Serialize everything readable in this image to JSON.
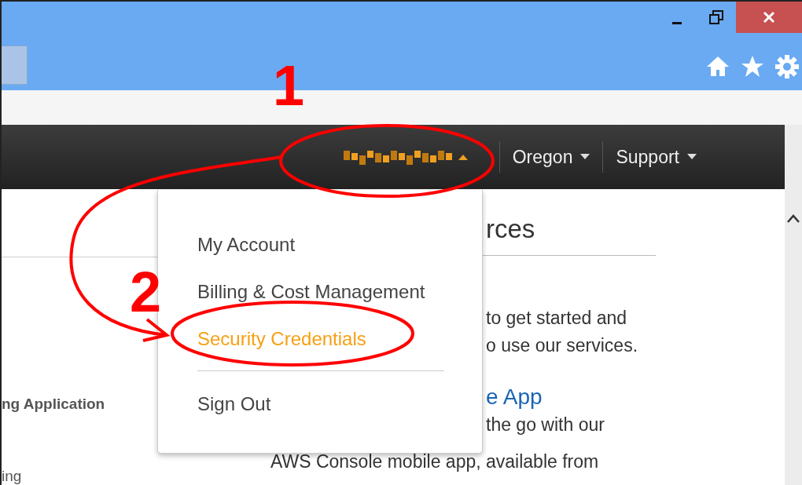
{
  "nav": {
    "items": [
      {
        "label": "Oregon"
      },
      {
        "label": "Support"
      }
    ]
  },
  "menu": {
    "items": [
      {
        "label": "My Account",
        "selected": false,
        "kind": "item"
      },
      {
        "label": "Billing & Cost Management",
        "selected": false,
        "kind": "item"
      },
      {
        "label": "Security Credentials",
        "selected": true,
        "kind": "item"
      },
      {
        "kind": "divider"
      },
      {
        "label": "Sign Out",
        "selected": false,
        "kind": "item"
      }
    ]
  },
  "left_column": [
    "ng Application",
    "ing"
  ],
  "right_column": [
    {
      "text": "rces",
      "kind": "heading"
    },
    {
      "text": "to get started and",
      "kind": "text"
    },
    {
      "text": "o use our services.",
      "kind": "text"
    },
    {
      "text": "e App",
      "kind": "link-heading"
    },
    {
      "text": "the go with our",
      "kind": "text"
    }
  ],
  "below_menu_text": "AWS Console mobile app, available from",
  "annotations": [
    {
      "label": "1"
    },
    {
      "label": "2"
    }
  ]
}
